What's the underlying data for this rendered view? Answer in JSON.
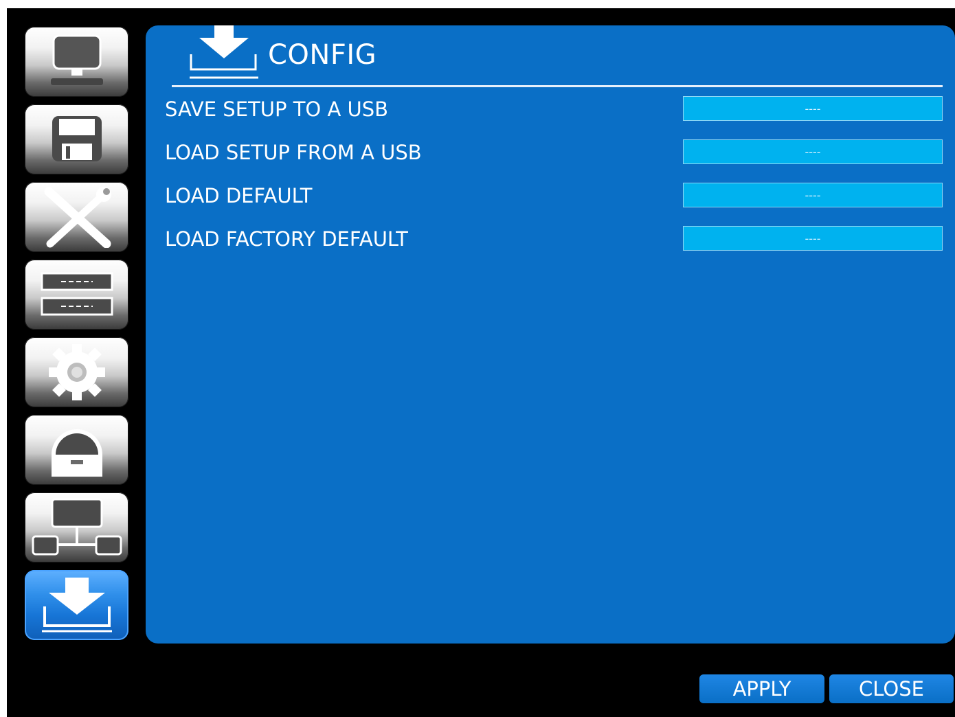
{
  "sidebar": {
    "items": [
      {
        "icon": "monitor-icon",
        "active": false
      },
      {
        "icon": "floppy-disk-icon",
        "active": false
      },
      {
        "icon": "tools-icon",
        "active": false
      },
      {
        "icon": "list-fields-icon",
        "active": false
      },
      {
        "icon": "gear-icon",
        "active": false
      },
      {
        "icon": "dome-camera-icon",
        "active": false
      },
      {
        "icon": "network-icon",
        "active": false
      },
      {
        "icon": "download-tray-icon",
        "active": true
      }
    ]
  },
  "panel": {
    "title": "CONFIG",
    "title_icon": "download-tray-icon",
    "rows": [
      {
        "label": "SAVE SETUP TO A USB",
        "value": "----"
      },
      {
        "label": "LOAD SETUP FROM A USB",
        "value": "----"
      },
      {
        "label": "LOAD DEFAULT",
        "value": "----"
      },
      {
        "label": "LOAD FACTORY DEFAULT",
        "value": "----"
      }
    ]
  },
  "footer": {
    "apply_label": "APPLY",
    "close_label": "CLOSE"
  },
  "colors": {
    "panel_bg": "#0a6fc6",
    "field_bg": "#00b2ef",
    "screen_bg": "#000000"
  }
}
